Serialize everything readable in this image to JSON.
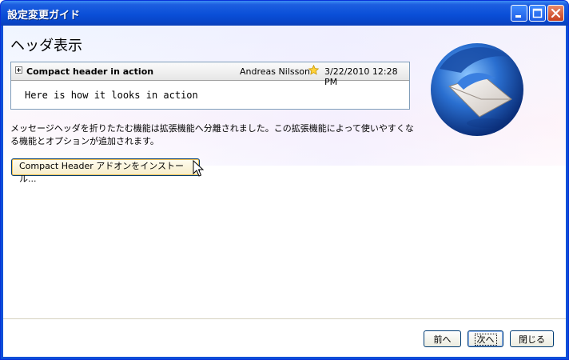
{
  "window": {
    "title": "設定変更ガイド",
    "accent": "#0a4fd8"
  },
  "page": {
    "heading": "ヘッダ表示",
    "description": "メッセージヘッダを折りたたむ機能は拡張機能へ分離されました。この拡張機能によって使いやすくなる機能とオプションが追加されます。"
  },
  "preview": {
    "subject": "Compact header in action",
    "from": "Andreas Nilsson",
    "date": "3/22/2010 12:28 PM",
    "body": "Here is how it looks in action"
  },
  "install_button": {
    "label": "Compact Header アドオンをインストール..."
  },
  "nav": {
    "prev_label": "前へ",
    "next_label": "次へ",
    "close_label": "閉じる"
  },
  "icons": {
    "minimize": "minimize-icon",
    "maximize": "maximize-icon",
    "close": "close-icon",
    "star": "star-icon",
    "logo": "thunderbird-logo"
  }
}
